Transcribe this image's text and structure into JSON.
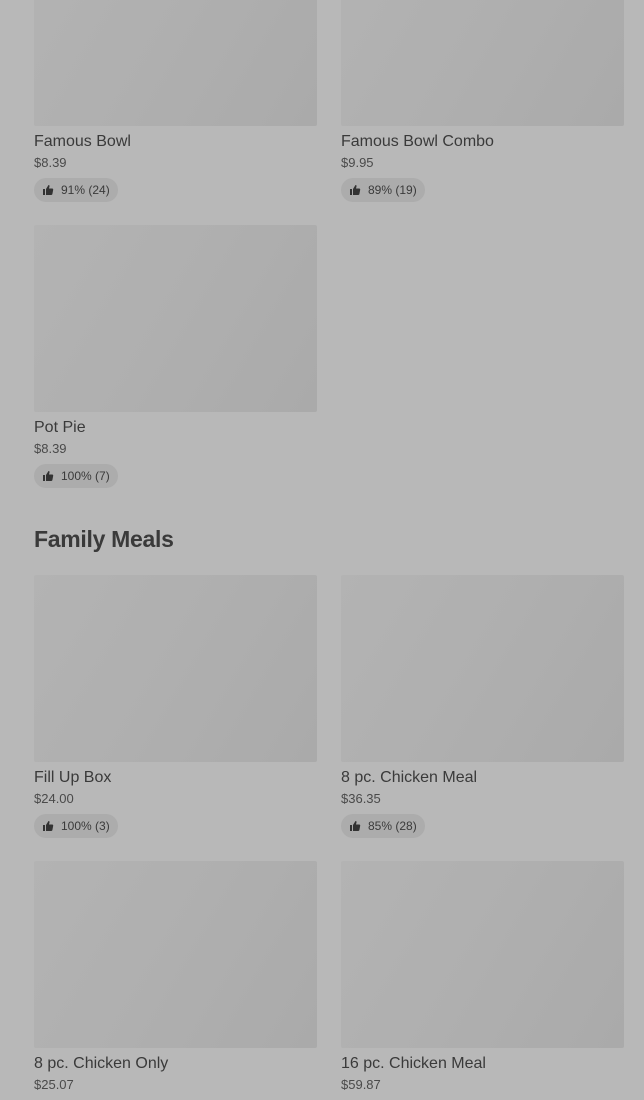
{
  "items": [
    {
      "title": "Famous Bowl",
      "price": "$8.39",
      "rating": "91% (24)"
    },
    {
      "title": "Famous Bowl Combo",
      "price": "$9.95",
      "rating": "89% (19)"
    },
    {
      "title": "Pot Pie",
      "price": "$8.39",
      "rating": "100% (7)"
    }
  ],
  "family_section": {
    "title": "Family Meals",
    "items": [
      {
        "title": "Fill Up Box",
        "price": "$24.00",
        "rating": "100% (3)"
      },
      {
        "title": "8 pc. Chicken Meal",
        "price": "$36.35",
        "rating": "85% (28)"
      },
      {
        "title": "8 pc. Chicken Only",
        "price": "$25.07"
      },
      {
        "title": "16 pc. Chicken Meal",
        "price": "$59.87"
      }
    ]
  },
  "icons": {
    "rating": "thumbs-up-icon"
  }
}
